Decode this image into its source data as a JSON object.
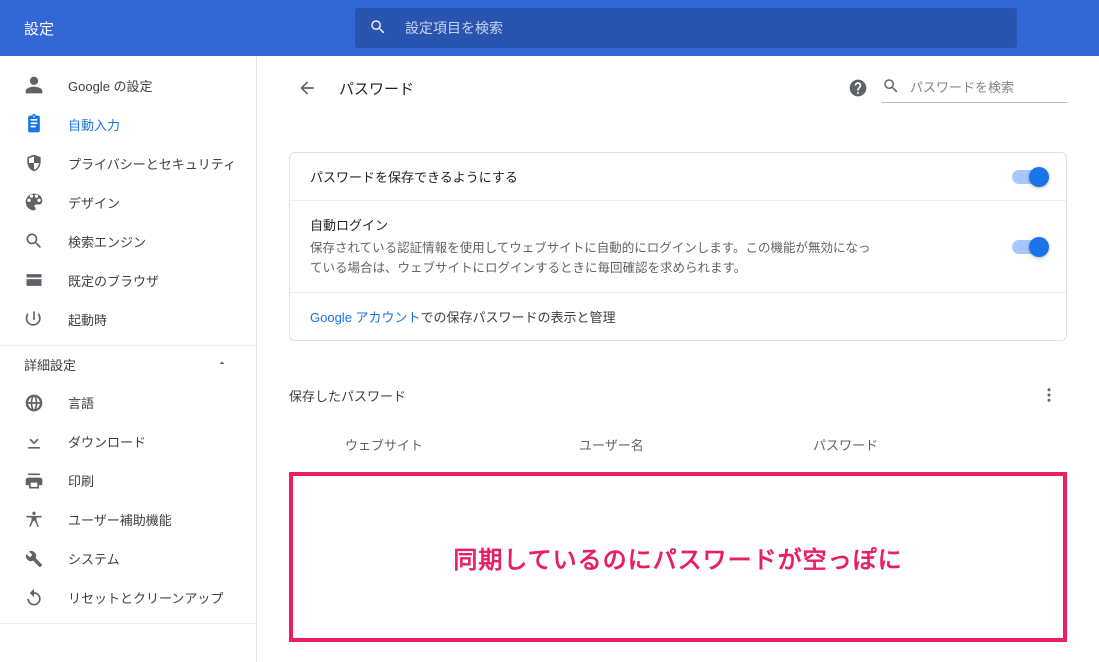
{
  "topbar": {
    "title": "設定",
    "search_placeholder": "設定項目を検索"
  },
  "sidebar": {
    "items_basic": [
      {
        "label": "Google の設定",
        "icon": "person"
      },
      {
        "label": "自動入力",
        "icon": "clipboard",
        "active": true
      },
      {
        "label": "プライバシーとセキュリティ",
        "icon": "shield"
      },
      {
        "label": "デザイン",
        "icon": "palette"
      },
      {
        "label": "検索エンジン",
        "icon": "search"
      },
      {
        "label": "既定のブラウザ",
        "icon": "browser"
      },
      {
        "label": "起動時",
        "icon": "power"
      }
    ],
    "advanced_label": "詳細設定",
    "items_advanced": [
      {
        "label": "言語",
        "icon": "globe"
      },
      {
        "label": "ダウンロード",
        "icon": "download"
      },
      {
        "label": "印刷",
        "icon": "print"
      },
      {
        "label": "ユーザー補助機能",
        "icon": "accessibility"
      },
      {
        "label": "システム",
        "icon": "wrench"
      },
      {
        "label": "リセットとクリーンアップ",
        "icon": "restore"
      }
    ]
  },
  "page": {
    "title": "パスワード",
    "search_placeholder": "パスワードを検索"
  },
  "rows": {
    "save_passwords": "パスワードを保存できるようにする",
    "auto_login_title": "自動ログイン",
    "auto_login_sub": "保存されている認証情報を使用してウェブサイトに自動的にログインします。この機能が無効になっている場合は、ウェブサイトにログインするときに毎回確認を求められます。",
    "google_link_head": "Google アカウント",
    "google_link_tail": "での保存パスワードの表示と管理"
  },
  "saved": {
    "section_title": "保存したパスワード",
    "col_site": "ウェブサイト",
    "col_user": "ユーザー名",
    "col_pass": "パスワード"
  },
  "annotation": "同期しているのにパスワードが空っぽに"
}
